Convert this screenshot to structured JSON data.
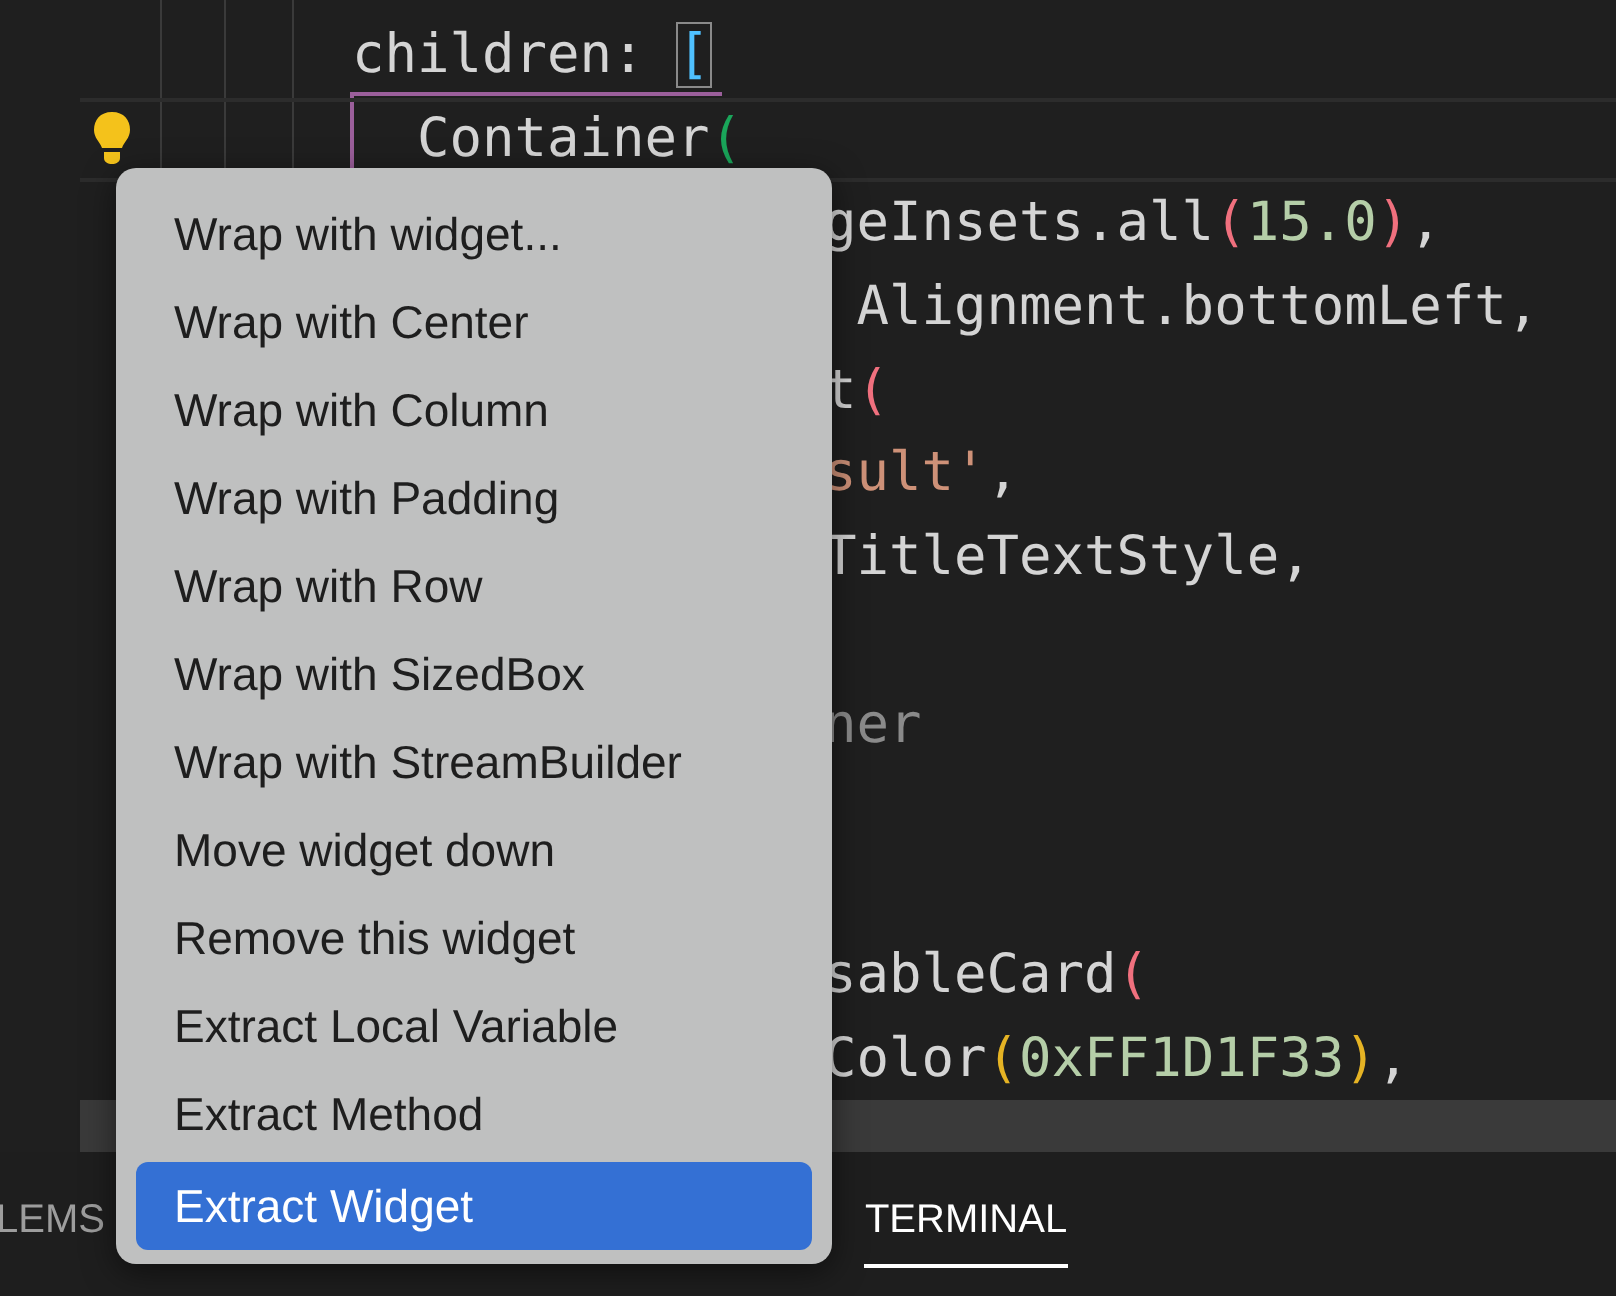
{
  "editor": {
    "lines": [
      {
        "kind": "full",
        "tokens": [
          {
            "kind": "plain",
            "text": "children: "
          },
          {
            "kind": "bracket",
            "text": "["
          }
        ]
      },
      {
        "kind": "full",
        "current": true,
        "lightbulb": true,
        "tokens": [
          {
            "kind": "plain",
            "text": "  Container"
          },
          {
            "kind": "paren_green",
            "text": "("
          }
        ]
      },
      {
        "kind": "clipped",
        "tokens": [
          {
            "kind": "plain",
            "text": "geInsets.all"
          },
          {
            "kind": "paren_pink",
            "text": "("
          },
          {
            "kind": "number",
            "text": "15.0"
          },
          {
            "kind": "paren_pink",
            "text": ")"
          },
          {
            "kind": "plain",
            "text": ","
          }
        ]
      },
      {
        "kind": "clipped",
        "tokens": [
          {
            "kind": "plain",
            "text": " Alignment.bottomLeft,"
          }
        ]
      },
      {
        "kind": "clipped",
        "tokens": [
          {
            "kind": "plain",
            "text": "t"
          },
          {
            "kind": "paren_pink",
            "text": "("
          }
        ]
      },
      {
        "kind": "clipped",
        "tokens": [
          {
            "kind": "string",
            "text": "sult'"
          },
          {
            "kind": "plain",
            "text": ","
          }
        ]
      },
      {
        "kind": "clipped",
        "tokens": [
          {
            "kind": "plain",
            "text": "TitleTextStyle,"
          }
        ]
      },
      {
        "kind": "empty"
      },
      {
        "kind": "clipped",
        "tokens": [
          {
            "kind": "comment",
            "text": "ner"
          }
        ]
      },
      {
        "kind": "empty"
      },
      {
        "kind": "empty"
      },
      {
        "kind": "clipped",
        "tokens": [
          {
            "kind": "plain",
            "text": "sableCard"
          },
          {
            "kind": "paren_pink",
            "text": "("
          }
        ]
      },
      {
        "kind": "clipped",
        "tokens": [
          {
            "kind": "plain",
            "text": "Color"
          },
          {
            "kind": "paren_gold",
            "text": "("
          },
          {
            "kind": "number",
            "text": "0xFF1D1F33"
          },
          {
            "kind": "paren_gold",
            "text": ")"
          },
          {
            "kind": "plain",
            "text": ","
          }
        ]
      },
      {
        "kind": "clipped",
        "highlighted": true
      }
    ]
  },
  "context_menu": {
    "items": [
      {
        "label": "Wrap with widget...",
        "selected": false
      },
      {
        "label": "Wrap with Center",
        "selected": false
      },
      {
        "label": "Wrap with Column",
        "selected": false
      },
      {
        "label": "Wrap with Padding",
        "selected": false
      },
      {
        "label": "Wrap with Row",
        "selected": false
      },
      {
        "label": "Wrap with SizedBox",
        "selected": false
      },
      {
        "label": "Wrap with StreamBuilder",
        "selected": false
      },
      {
        "label": "Move widget down",
        "selected": false
      },
      {
        "label": "Remove this widget",
        "selected": false
      },
      {
        "label": "Extract Local Variable",
        "selected": false
      },
      {
        "label": "Extract Method",
        "selected": false
      },
      {
        "label": "Extract Widget",
        "selected": true
      }
    ]
  },
  "panel": {
    "tabs": [
      {
        "label": "LEMS",
        "selected": false
      },
      {
        "label": "TERMINAL",
        "selected": true
      }
    ]
  }
}
